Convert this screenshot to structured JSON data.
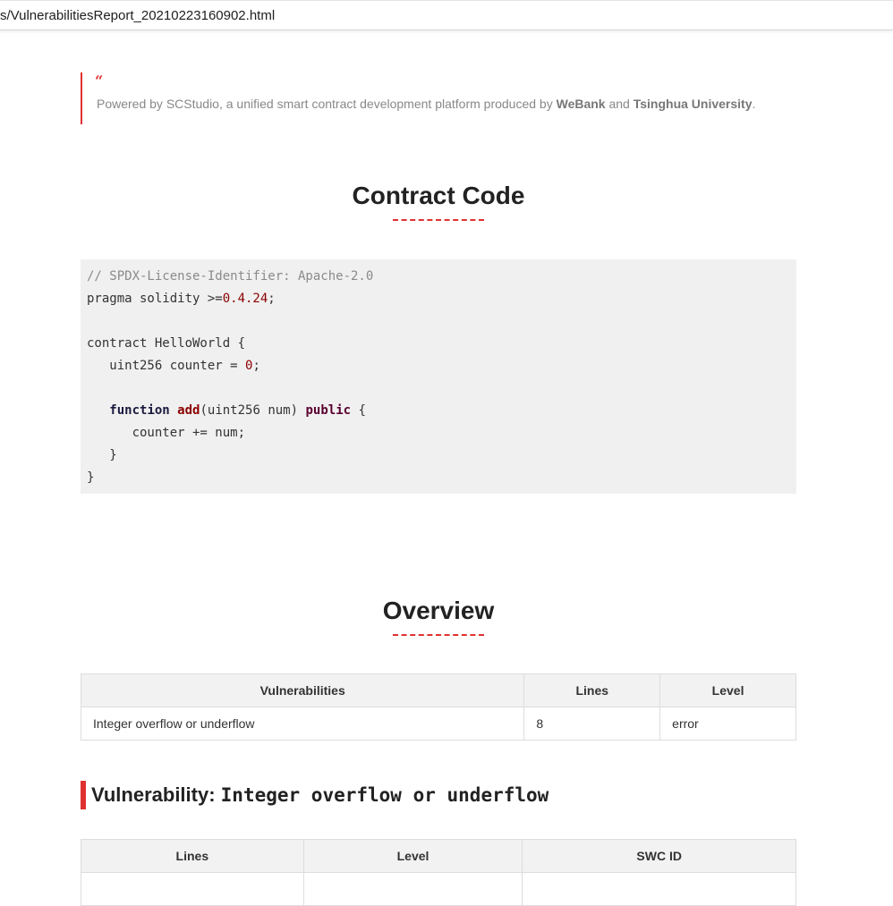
{
  "address_bar": {
    "url": "s/VulnerabilitiesReport_20210223160902.html"
  },
  "quote": {
    "mark": "“",
    "text_prefix": "Powered by SCStudio, a unified smart contract development platform produced by ",
    "org1": "WeBank",
    "text_and": " and ",
    "org2": "Tsinghua University",
    "text_end": "."
  },
  "contract_section": {
    "title": "Contract Code"
  },
  "code": {
    "line1_comment": "// SPDX-License-Identifier: Apache-2.0",
    "line2_a": "pragma solidity >=",
    "line2_version": "0.4.24",
    "line2_b": ";",
    "line4": "contract HelloWorld {",
    "line5_a": "   uint256 counter = ",
    "line5_num": "0",
    "line5_b": ";",
    "line7_indent": "   ",
    "line7_kw": "function",
    "line7_sp": " ",
    "line7_fn": "add",
    "line7_args": "(uint256 num) ",
    "line7_pub": "public",
    "line7_end": " {",
    "line8": "      counter += num;",
    "line9": "   }",
    "line10": "}"
  },
  "overview_section": {
    "title": "Overview",
    "headers": [
      "Vulnerabilities",
      "Lines",
      "Level"
    ],
    "rows": [
      [
        "Integer overflow or underflow",
        "8",
        "error"
      ]
    ]
  },
  "vulnerability": {
    "prefix": "Vulnerability: ",
    "name": "Integer overflow or underflow",
    "headers": [
      "Lines",
      "Level",
      "SWC ID"
    ]
  },
  "colors": {
    "accent": "#e03131",
    "code_background": "#f0f0f0",
    "table_header_background": "#f2f2f2"
  }
}
